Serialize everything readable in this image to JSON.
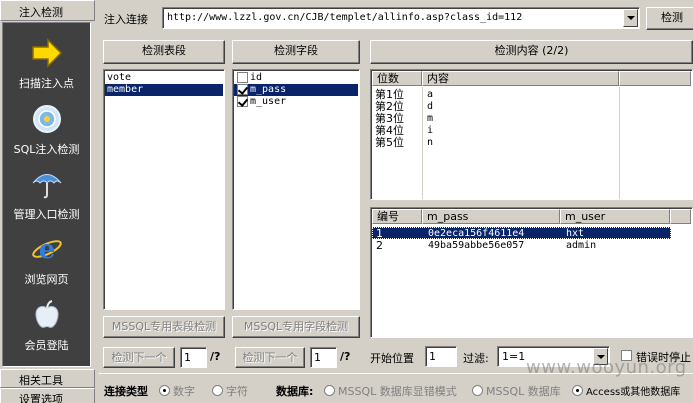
{
  "sidebar": {
    "header": "注入检测",
    "items": [
      {
        "label": "扫描注入点",
        "icon": "arrow-icon"
      },
      {
        "label": "SQL注入检测",
        "icon": "target-icon"
      },
      {
        "label": "管理入口检测",
        "icon": "umbrella-icon"
      },
      {
        "label": "浏览网页",
        "icon": "ie-browser-icon"
      },
      {
        "label": "会员登陆",
        "icon": "apple-icon"
      }
    ],
    "related_tools": "相关工具",
    "settings": "设置选项"
  },
  "top": {
    "label": "注入连接",
    "url": "http://www.lzzl.gov.cn/CJB/templet/allinfo.asp?class_id=112",
    "detect_button": "检测"
  },
  "tables_panel": {
    "title": "检测表段",
    "items": [
      "vote",
      "member"
    ],
    "selected_index": 1,
    "mssql_button": "MSSQL专用表段检测",
    "next_button": "检测下一个",
    "page": "1",
    "page_total": "/?"
  },
  "fields_panel": {
    "title": "检测字段",
    "items": [
      {
        "name": "id",
        "checked": false
      },
      {
        "name": "m_pass",
        "checked": true
      },
      {
        "name": "m_user",
        "checked": true
      }
    ],
    "selected_index": 1,
    "mssql_button": "MSSQL专用字段检测",
    "next_button": "检测下一个",
    "page": "1",
    "page_total": "/?"
  },
  "content_panel": {
    "title": "检测内容 (2/2)",
    "pos_headers": [
      "位数",
      "内容"
    ],
    "pos_rows": [
      [
        "第1位",
        "a"
      ],
      [
        "第2位",
        "d"
      ],
      [
        "第3位",
        "m"
      ],
      [
        "第4位",
        "i"
      ],
      [
        "第5位",
        "n"
      ]
    ],
    "result_headers": [
      "编号",
      "m_pass",
      "m_user"
    ],
    "result_rows": [
      [
        "1",
        "0e2eca156f4611e4",
        "hxt"
      ],
      [
        "2",
        "49ba59abbe56e057",
        "admin"
      ]
    ],
    "selected_row": 0,
    "start_label": "开始位置",
    "start_value": "1",
    "filter_label": "过滤:",
    "filter_value": "1=1",
    "error_checkbox": "错误时停止"
  },
  "bottom": {
    "conn_label": "连接类型",
    "conn_options": [
      "数字",
      "字符"
    ],
    "db_label": "数据库:",
    "db_options": [
      "MSSQL 数据库显错模式",
      "MSSQL 数据库",
      "Access或其他数据库"
    ],
    "db_selected": 2
  },
  "watermark": "www.wooyun.org",
  "colors": {
    "selection": "#0a246a",
    "sidebar_panel": "#404040",
    "face": "#d4d0c8"
  }
}
